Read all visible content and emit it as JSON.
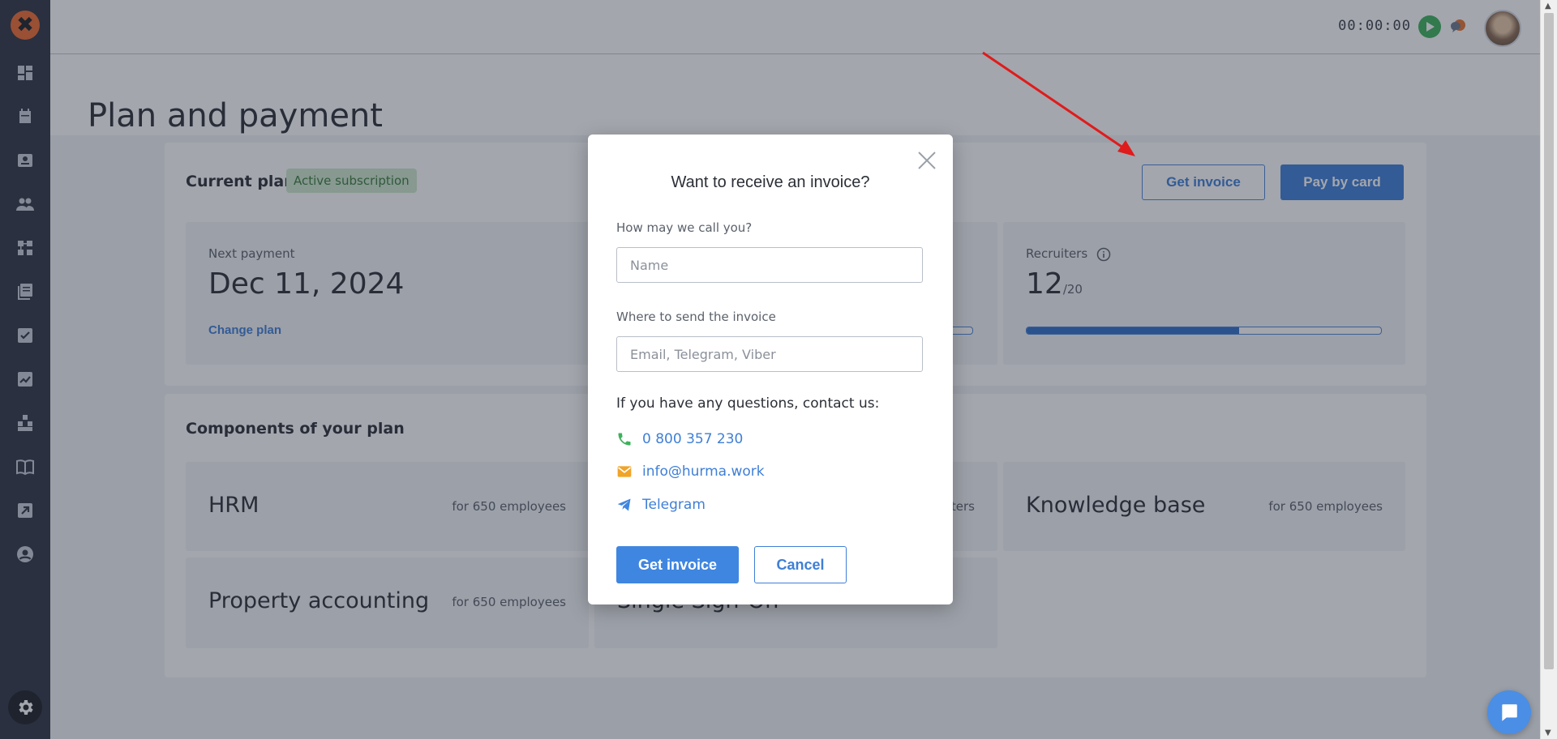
{
  "header": {
    "timer": "00:00:00"
  },
  "page": {
    "title": "Plan and payment"
  },
  "plan": {
    "heading": "Current plan",
    "badge": "Active subscription",
    "get_invoice_label": "Get invoice",
    "pay_by_card_label": "Pay by card",
    "next_payment_label": "Next payment",
    "next_payment_date": "Dec 11, 2024",
    "change_plan_label": "Change plan",
    "recruiters_label": "Recruiters",
    "recruiters_used": "12",
    "recruiters_total": "/20",
    "recruiters_fraction": 0.6
  },
  "components": {
    "heading": "Components of your plan",
    "items": [
      {
        "name": "HRM",
        "count": "for 650 employees"
      },
      {
        "name": "Knowledge base",
        "count": "for 650 employees"
      },
      {
        "name": "Property accounting",
        "count": "for 650 employees"
      },
      {
        "name": "Single Sign-On",
        "count": ""
      }
    ],
    "partial_count": "ters"
  },
  "modal": {
    "title": "Want to receive an invoice?",
    "name_label": "How may we call you?",
    "name_placeholder": "Name",
    "name_value": "",
    "send_label": "Where to send the invoice",
    "send_placeholder": "Email, Telegram, Viber",
    "send_value": "",
    "questions": "If you have any questions, contact us:",
    "phone": "0 800 357 230",
    "email": "info@hurma.work",
    "telegram": "Telegram",
    "submit_label": "Get invoice",
    "cancel_label": "Cancel"
  },
  "colors": {
    "accent": "#3f7fd6",
    "sidebar": "#2f3543",
    "logo": "#ef6c2f",
    "overlay": "rgba(35,42,60,0.42)",
    "annotation_arrow": "#e01b1b"
  },
  "icons": {
    "sidebar": [
      "dashboard-icon",
      "calendar-icon",
      "profile-card-icon",
      "people-icon",
      "org-structure-icon",
      "library-icon",
      "checklist-icon",
      "analytics-icon",
      "blocks-icon",
      "book-icon",
      "export-icon",
      "user-circle-icon"
    ],
    "bottom": "gear-icon"
  }
}
